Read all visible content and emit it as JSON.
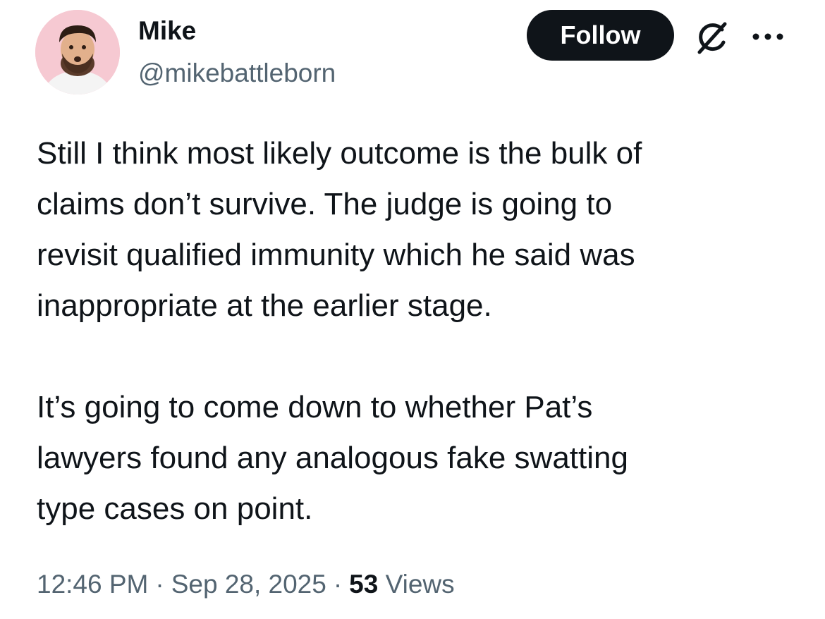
{
  "author": {
    "display_name": "Mike",
    "handle": "@mikebattleborn",
    "avatar_icon": "profile-photo"
  },
  "actions": {
    "follow_label": "Follow",
    "grok_icon": "grok-icon",
    "more_icon": "more-options-icon"
  },
  "tweet": {
    "paragraphs": [
      "Still I think most likely outcome is the bulk of\nclaims don’t survive. The judge is going to\nrevisit qualified immunity which he said was\ninappropriate at the earlier stage.",
      "It’s going to come down to whether Pat’s\nlawyers found any analogous fake swatting\ntype cases on point."
    ]
  },
  "meta": {
    "time": "12:46 PM",
    "separator": "·",
    "date": "Sep 28, 2025",
    "views_count": "53",
    "views_label": "Views"
  },
  "colors": {
    "text_primary": "#0f1419",
    "text_secondary": "#536471",
    "button_bg": "#0f1419",
    "avatar_bg": "#f6c9d2"
  }
}
